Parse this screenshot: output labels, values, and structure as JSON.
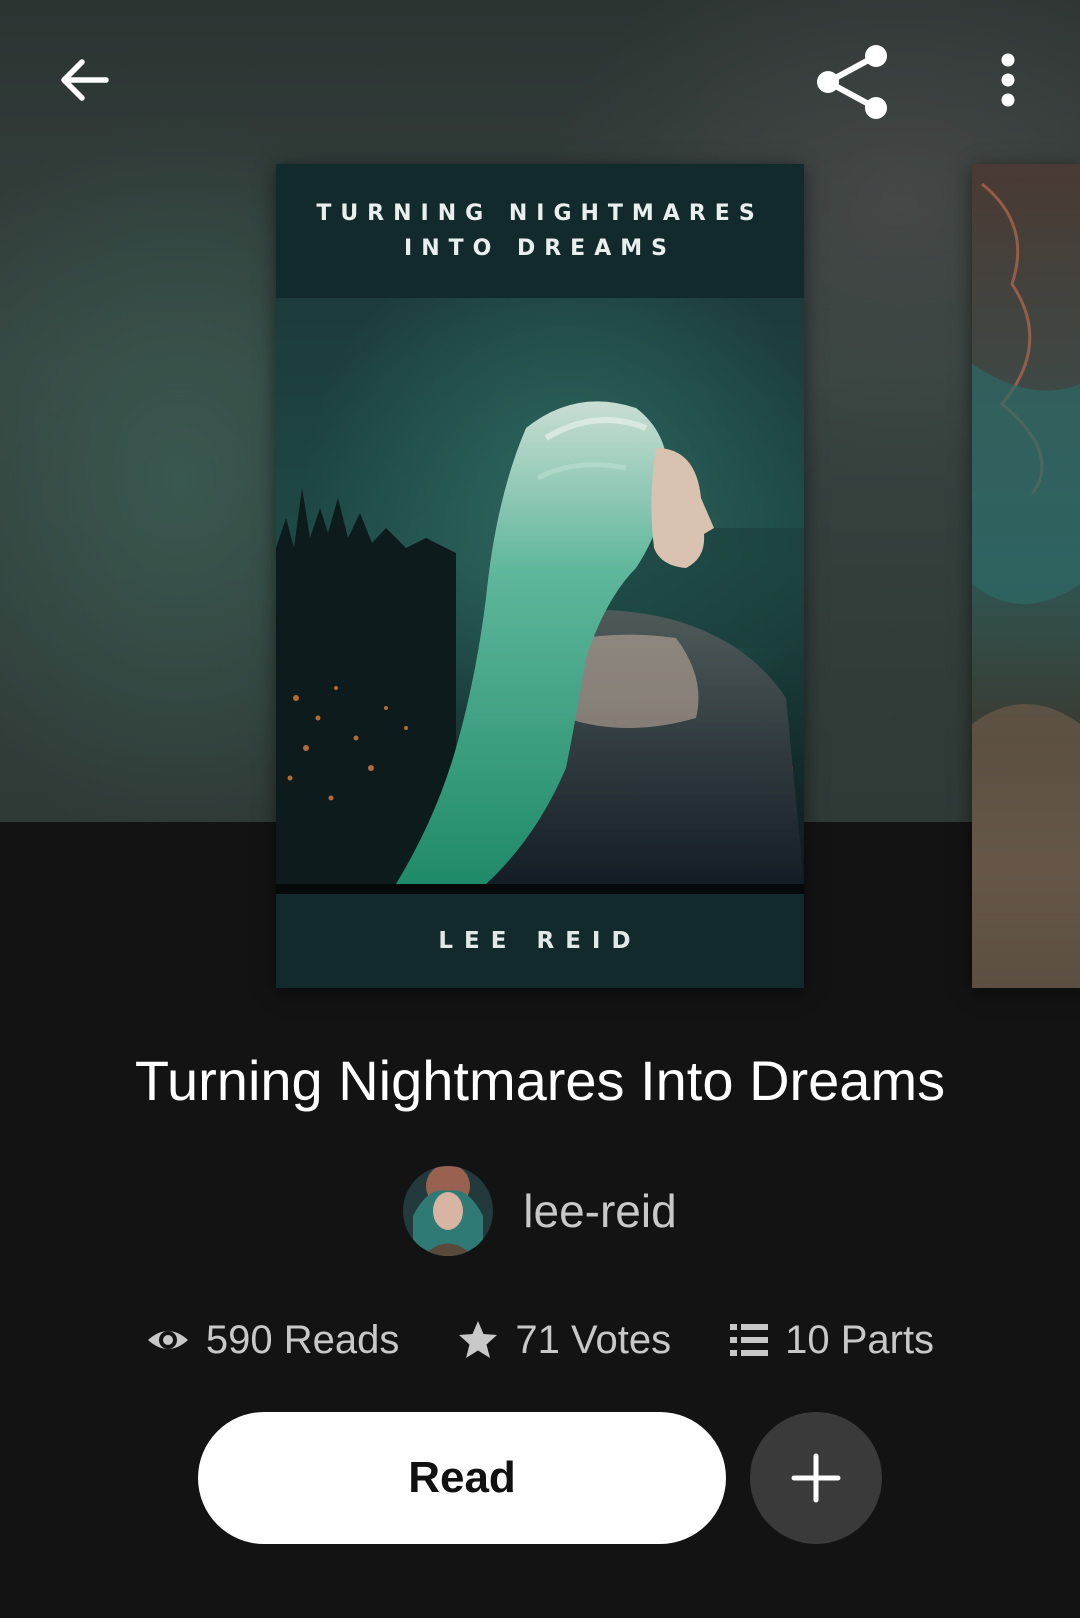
{
  "book": {
    "title": "Turning Nightmares Into Dreams",
    "cover_title_line1": "TURNING NIGHTMARES",
    "cover_title_line2": "INTO DREAMS",
    "cover_author": "LEE REID"
  },
  "author": {
    "username": "lee-reid"
  },
  "stats": {
    "reads": "590 Reads",
    "votes": "71 Votes",
    "parts": "10 Parts"
  },
  "actions": {
    "read_label": "Read"
  },
  "icons": {
    "back": "arrow-left-icon",
    "share": "share-icon",
    "more": "more-vertical-icon",
    "reads": "eye-icon",
    "votes": "star-icon",
    "parts": "list-icon",
    "add": "plus-icon"
  },
  "colors": {
    "background": "#131313",
    "cover_band": "#132a2c",
    "button_primary": "#ffffff",
    "button_secondary": "#3a3a3a",
    "muted_text": "#c8c8c8"
  }
}
